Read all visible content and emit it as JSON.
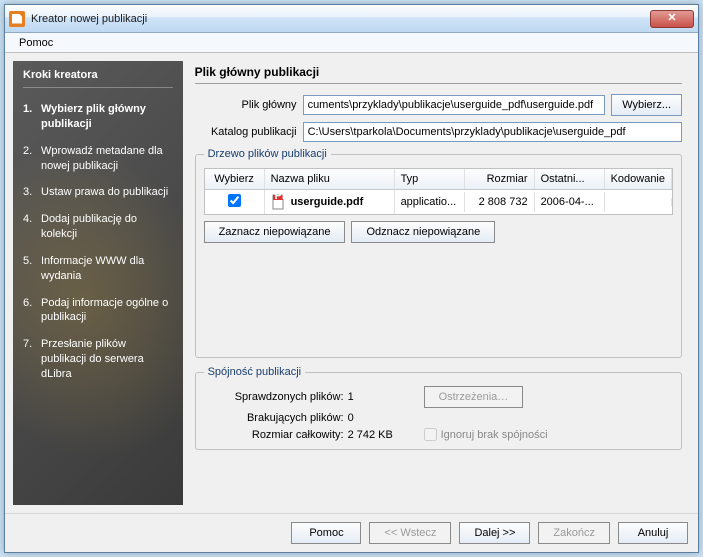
{
  "window": {
    "title": "Kreator nowej publikacji"
  },
  "menubar": {
    "help": "Pomoc"
  },
  "sidebar": {
    "header": "Kroki kreatora",
    "steps": [
      "Wybierz plik główny publikacji",
      "Wprowadź metadane dla nowej publikacji",
      "Ustaw prawa do publikacji",
      "Dodaj publikację do kolekcji",
      "Informacje WWW dla wydania",
      "Podaj informacje ogólne o publikacji",
      "Przesłanie plików publikacji do serwera dLibra"
    ]
  },
  "main": {
    "header": "Plik główny publikacji",
    "mainfile": {
      "label": "Plik główny",
      "value": "cuments\\przyklady\\publikacje\\userguide_pdf\\userguide.pdf",
      "browse": "Wybierz..."
    },
    "catalog": {
      "label": "Katalog publikacji",
      "value": "C:\\Users\\tparkola\\Documents\\przyklady\\publikacje\\userguide_pdf"
    },
    "tree": {
      "legend": "Drzewo plików publikacji",
      "headers": {
        "select": "Wybierz",
        "name": "Nazwa pliku",
        "type": "Typ",
        "size": "Rozmiar",
        "modified": "Ostatni...",
        "encoding": "Kodowanie"
      },
      "rows": [
        {
          "selected": true,
          "name": "userguide.pdf",
          "type": "applicatio...",
          "size": "2 808 732",
          "modified": "2006-04-...",
          "encoding": ""
        }
      ],
      "markUnbound": "Zaznacz niepowiązane",
      "unmarkUnbound": "Odznacz niepowiązane"
    },
    "coherence": {
      "legend": "Spójność publikacji",
      "checkedLabel": "Sprawdzonych plików:",
      "checkedValue": "1",
      "missingLabel": "Brakujących plików:",
      "missingValue": "0",
      "sizeLabel": "Rozmiar całkowity:",
      "sizeValue": "2 742 KB",
      "warnings": "Ostrzeżenia…",
      "ignore": "Ignoruj brak spójności"
    }
  },
  "footer": {
    "help": "Pomoc",
    "back": "<< Wstecz",
    "next": "Dalej >>",
    "finish": "Zakończ",
    "cancel": "Anuluj"
  }
}
